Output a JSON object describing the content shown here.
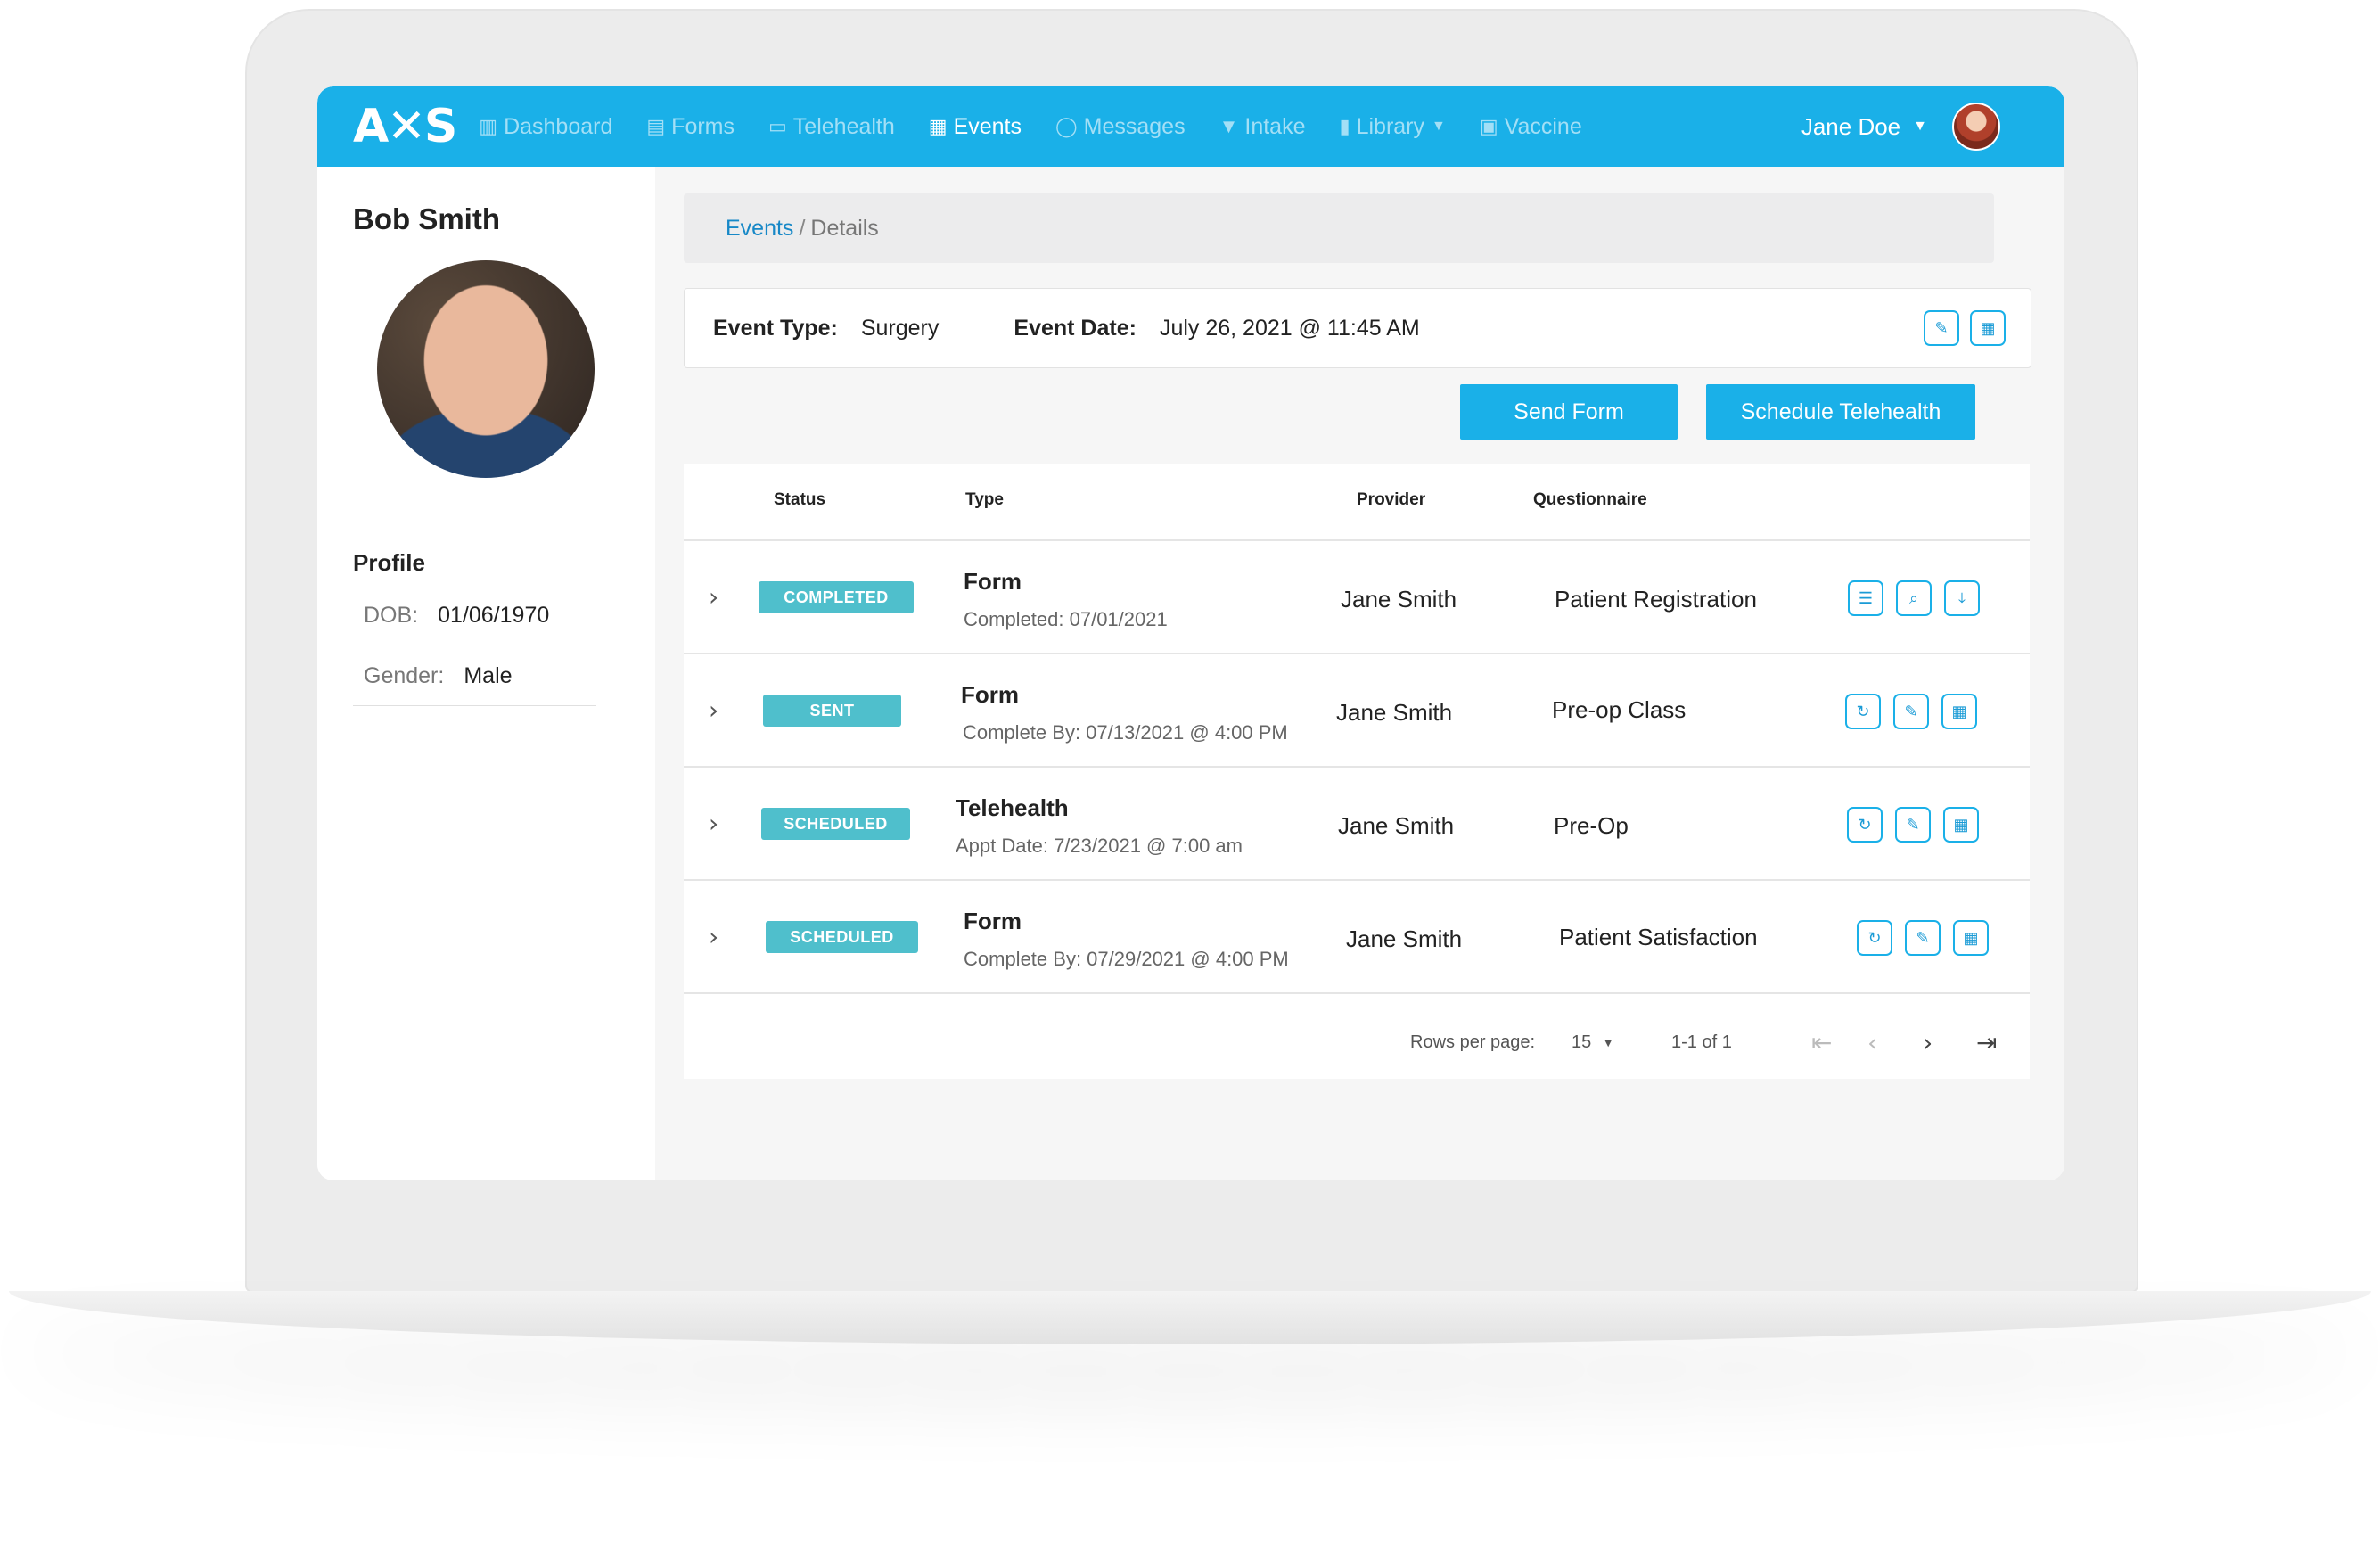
{
  "nav": {
    "logo": "A✕S",
    "items": [
      {
        "label": "Dashboard",
        "icon": "bar-chart-icon",
        "glyph": "📊",
        "active": false
      },
      {
        "label": "Forms",
        "icon": "document-icon",
        "glyph": "📄",
        "active": false
      },
      {
        "label": "Telehealth",
        "icon": "monitor-icon",
        "glyph": "🖵",
        "active": false
      },
      {
        "label": "Events",
        "icon": "calendar-icon",
        "glyph": "📅",
        "active": true
      },
      {
        "label": "Messages",
        "icon": "chat-icon",
        "glyph": "💬",
        "active": false
      },
      {
        "label": "Intake",
        "icon": "filter-icon",
        "glyph": "⏷",
        "active": false
      },
      {
        "label": "Library",
        "icon": "book-icon",
        "glyph": "📘",
        "active": false,
        "dropdown": true
      },
      {
        "label": "Vaccine",
        "icon": "medkit-icon",
        "glyph": "🧰",
        "active": false
      }
    ],
    "user_name": "Jane Doe"
  },
  "patient": {
    "name": "Bob Smith",
    "profile_label": "Profile",
    "dob_label": "DOB:",
    "dob": "01/06/1970",
    "gender_label": "Gender:",
    "gender": "Male"
  },
  "breadcrumb": {
    "link": "Events",
    "separator": "/",
    "current": "Details"
  },
  "event": {
    "type_label": "Event Type:",
    "type": "Surgery",
    "date_label": "Event Date:",
    "date": "July 26, 2021 @ 11:45 AM"
  },
  "actions": {
    "send_form": "Send Form",
    "schedule_telehealth": "Schedule Telehealth"
  },
  "table": {
    "headers": {
      "status": "Status",
      "type": "Type",
      "provider": "Provider",
      "questionnaire": "Questionnaire"
    },
    "rows": [
      {
        "status": "COMPLETED",
        "type": "Form",
        "sub": "Completed: 07/01/2021",
        "provider": "Jane Smith",
        "questionnaire": "Patient Registration",
        "actions": [
          "list-icon",
          "search-doc-icon",
          "download-icon"
        ]
      },
      {
        "status": "SENT",
        "type": "Form",
        "sub": "Complete By: 07/13/2021 @ 4:00 PM",
        "provider": "Jane Smith",
        "questionnaire": "Pre-op Class",
        "actions": [
          "resend-icon",
          "edit-icon",
          "calendar-icon"
        ]
      },
      {
        "status": "SCHEDULED",
        "type": "Telehealth",
        "sub": "Appt Date: 7/23/2021 @ 7:00 am",
        "provider": "Jane Smith",
        "questionnaire": "Pre-Op",
        "actions": [
          "resend-icon",
          "edit-icon",
          "calendar-icon"
        ]
      },
      {
        "status": "SCHEDULED",
        "type": "Form",
        "sub": "Complete By: 07/29/2021 @ 4:00 PM",
        "provider": "Jane Smith",
        "questionnaire": "Patient Satisfaction",
        "actions": [
          "resend-icon",
          "edit-icon",
          "calendar-icon"
        ]
      }
    ],
    "rows_per_page_label": "Rows per page:",
    "rows_per_page": "15",
    "range": "1-1 of 1"
  },
  "colors": {
    "primary": "#1ab0e8",
    "badge": "#4fbfcc",
    "link": "#1788c7"
  }
}
